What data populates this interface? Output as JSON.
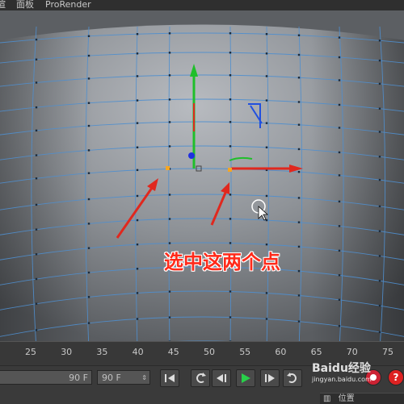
{
  "menubar": {
    "items": [
      {
        "label": "渲"
      },
      {
        "label": "面板"
      },
      {
        "label": "ProRender"
      }
    ]
  },
  "viewport": {
    "annotation_text": "选中这两个点",
    "selected_point_color": "#f5a623",
    "mesh_edge_color": "#4f8fcf",
    "axis_colors": {
      "x": "#e0281e",
      "y": "#1fbf2a",
      "z": "#2050e0"
    }
  },
  "timeline": {
    "ticks": [
      "25",
      "30",
      "35",
      "40",
      "45",
      "50",
      "55",
      "60",
      "65",
      "70",
      "75"
    ]
  },
  "controls": {
    "end_frame_value": "90 F",
    "preview_max_value": "90 F",
    "icons": [
      "goto-start-icon",
      "loop-icon",
      "prev-key-icon",
      "play-forward-icon",
      "next-key-icon",
      "record-icon"
    ]
  },
  "attributes": {
    "position_label": "位置"
  },
  "watermark": {
    "text": "Baidu经验",
    "subtext": "jingyan.baidu.com"
  }
}
